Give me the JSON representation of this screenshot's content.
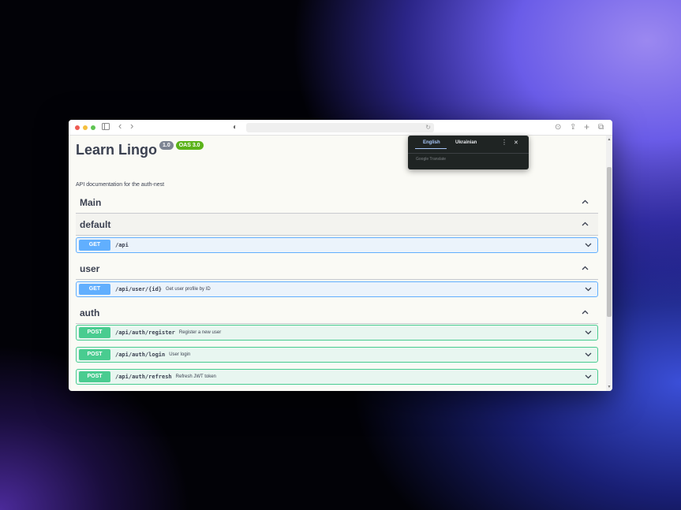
{
  "app": {
    "title": "Learn Lingo",
    "version_badge": "1.0",
    "spec_badge": "OAS 3.0",
    "description": "API documentation for the auth-nest"
  },
  "browser": {
    "sidebar_icon": "sidebar-icon",
    "back_icon": "‹",
    "forward_icon": "›",
    "shield_icon": "◐",
    "reload_icon": "↻",
    "download_icon": "⊙",
    "share_icon": "⇪",
    "new_tab_icon": "+",
    "tabs_icon": "⧉"
  },
  "translate_popup": {
    "tab_english": "English",
    "tab_ukrainian": "Ukrainian",
    "more_icon": "⋮",
    "close_icon": "✕",
    "footer": "Google Translate"
  },
  "sections": {
    "main": {
      "name": "Main",
      "chevron": "^"
    },
    "default": {
      "name": "default",
      "chevron": "^"
    },
    "user": {
      "name": "user",
      "chevron": "^"
    },
    "auth": {
      "name": "auth",
      "chevron": "^"
    }
  },
  "operations": {
    "api_get": {
      "method": "GET",
      "path": "/api",
      "summary": "",
      "chevron": "⌄"
    },
    "user_get": {
      "method": "GET",
      "path": "/api/user/{id}",
      "summary": "Get user profile by ID",
      "chevron": "⌄"
    },
    "register": {
      "method": "POST",
      "path": "/api/auth/register",
      "summary": "Register a new user",
      "chevron": "⌄"
    },
    "login": {
      "method": "POST",
      "path": "/api/auth/login",
      "summary": "User login",
      "chevron": "⌄"
    },
    "refresh": {
      "method": "POST",
      "path": "/api/auth/refresh",
      "summary": "Refresh JWT token",
      "chevron": "⌄"
    }
  },
  "colors": {
    "get": "#61affe",
    "post": "#49cc90",
    "oas_badge": "#5bb319",
    "version_badge": "#7d8492"
  }
}
